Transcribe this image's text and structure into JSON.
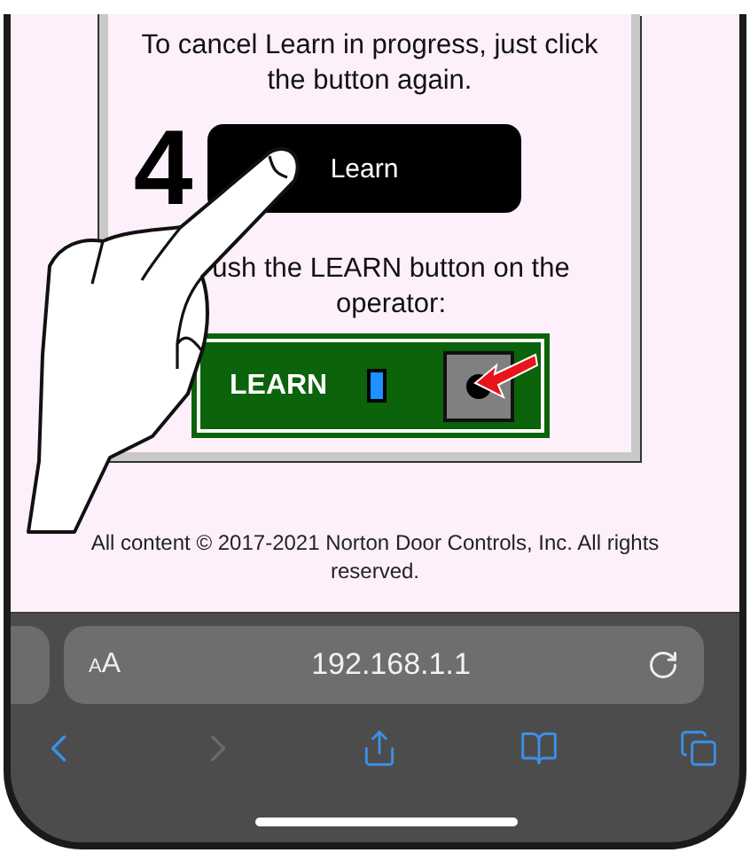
{
  "page": {
    "instruction_top": "To cancel Learn in progress, just click the button again.",
    "step_number": "4",
    "learn_button": "Learn",
    "instruction_bottom": "ush the LEARN button on the operator:",
    "board_label": "LEARN",
    "footer": "All content © 2017-2021 Norton Door Controls, Inc. All rights reserved."
  },
  "browser": {
    "text_size_button": "AA",
    "url": "192.168.1.1",
    "toolbar": [
      {
        "kind": "back",
        "disabled": false
      },
      {
        "kind": "forward",
        "disabled": true
      },
      {
        "kind": "share",
        "disabled": false
      },
      {
        "kind": "bookmarks",
        "disabled": false
      },
      {
        "kind": "tabs",
        "disabled": false
      }
    ]
  }
}
